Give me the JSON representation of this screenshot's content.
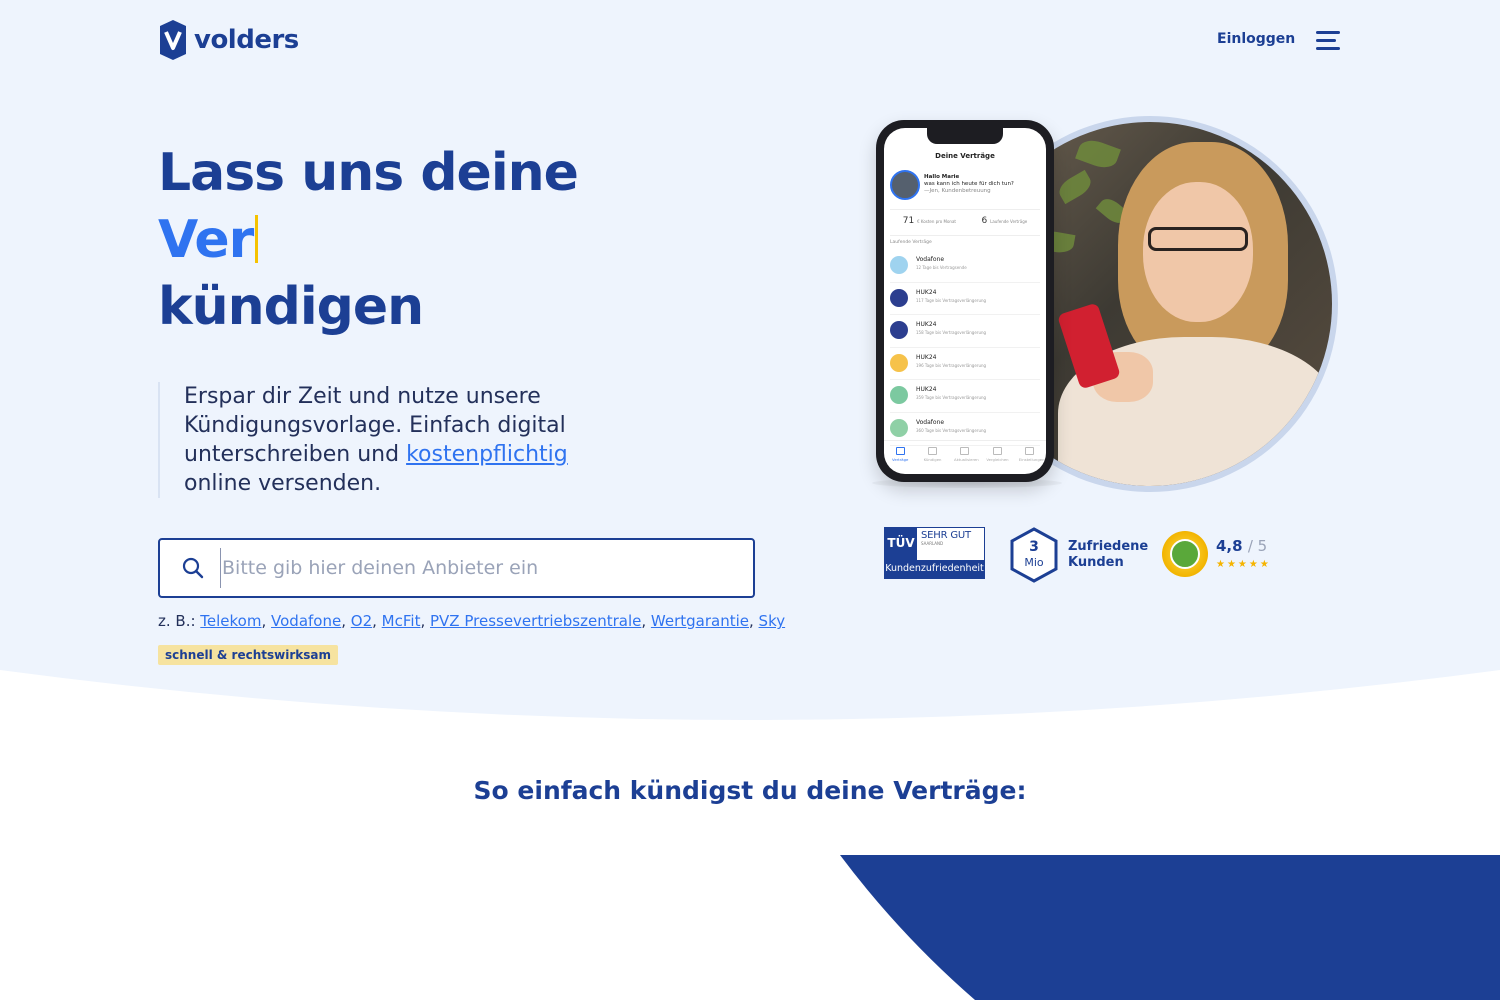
{
  "brand": {
    "name": "volders"
  },
  "nav": {
    "login": "Einloggen",
    "menu_icon": "hamburger-icon"
  },
  "hero": {
    "headline_line1": "Lass uns deine",
    "headline_typed": "Ver",
    "headline_line3": "kündigen",
    "lead_before": "Erspar dir Zeit und nutze unsere Kündigungsvorlage. Einfach digital unterschreiben und ",
    "lead_link": "kostenpflichtig",
    "lead_after": " online versenden."
  },
  "search": {
    "placeholder": "Bitte gib hier deinen Anbieter ein",
    "value": "",
    "icon": "search-icon"
  },
  "examples": {
    "prefix": "z. B.: ",
    "items": [
      "Telekom",
      "Vodafone",
      "O2",
      "McFit",
      "PVZ Pressevertriebszentrale",
      "Wertgarantie",
      "Sky"
    ]
  },
  "badge": "schnell & rechtswirksam",
  "phone_screen": {
    "title": "Deine Verträge",
    "greeting_name": "Hallo Marie",
    "greeting_text": "was kann ich heute für dich tun?",
    "greeting_sign": "—Jen, Kundenbetreuung",
    "stat_cost": "71",
    "stat_cost_label": "€ Kosten pro Monat",
    "stat_count": "6",
    "stat_count_label": "Laufende Verträge",
    "section_label": "Laufende Verträge",
    "contracts": [
      {
        "name": "Vodafone",
        "sub": "12 Tage bis Vertragsende",
        "color": "#9fd3ef"
      },
      {
        "name": "HUK24",
        "sub": "117 Tage bis Vertragsverlängerung",
        "color": "#2c3e8f"
      },
      {
        "name": "HUK24",
        "sub": "158 Tage bis Vertragsverlängerung",
        "color": "#2c3e8f"
      },
      {
        "name": "HUK24",
        "sub": "196 Tage bis Vertragsverlängerung",
        "color": "#f6c24a"
      },
      {
        "name": "HUK24",
        "sub": "359 Tage bis Vertragsverlängerung",
        "color": "#7cc9a0"
      },
      {
        "name": "Vodafone",
        "sub": "360 Tage bis Vertragsverlängerung",
        "color": "#8fd0a6"
      }
    ],
    "tabs": [
      "Verträge",
      "Kündigen",
      "Aktualisieren",
      "Vergleichen",
      "Einstellungen"
    ]
  },
  "trust": {
    "tuv_logo": "TÜV",
    "tuv_region": "SAARLAND",
    "tuv_grade": "SEHR GUT",
    "tuv_label": "Kundenzufriedenheit",
    "customers_number": "3",
    "customers_unit": "Mio",
    "customers_label_1": "Zufriedene",
    "customers_label_2": "Kunden",
    "rating_value": "4,8",
    "rating_of": "/ 5",
    "rating_stars": 5
  },
  "section2": {
    "title": "So einfach kündigst du deine Verträge:"
  },
  "colors": {
    "brand_blue": "#1c3f94",
    "accent_blue": "#2f73f0",
    "hero_bg": "#eef4fd",
    "badge_bg": "#f6e3a0",
    "caret": "#f5c200"
  }
}
